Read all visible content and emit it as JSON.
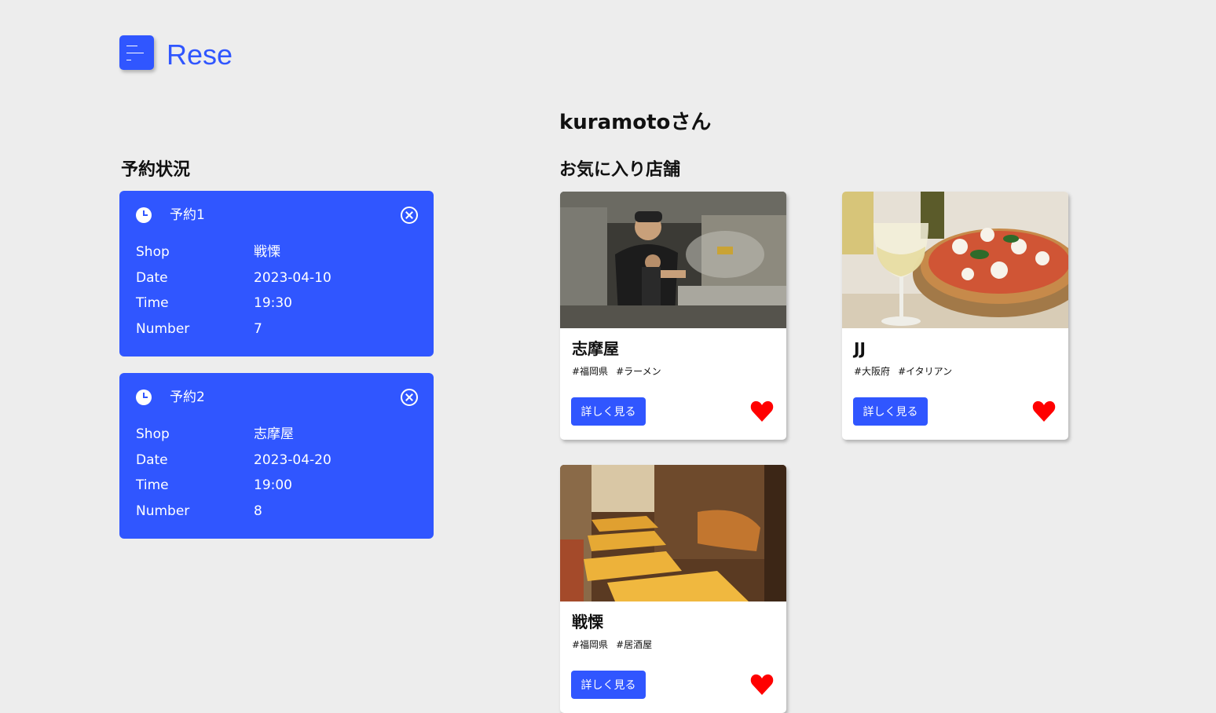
{
  "header": {
    "logo": "Rese",
    "menu_icon": "hamburger-menu-icon",
    "accent_color": "#3056ff"
  },
  "user": {
    "greeting": "kuramotoさん"
  },
  "reservations": {
    "title": "予約状況",
    "items": [
      {
        "label": "予約1",
        "shop_label": "Shop",
        "shop": "戦慄",
        "date_label": "Date",
        "date": "2023-04-10",
        "time_label": "Time",
        "time": "19:30",
        "number_label": "Number",
        "number": "7"
      },
      {
        "label": "予約2",
        "shop_label": "Shop",
        "shop": "志摩屋",
        "date_label": "Date",
        "date": "2023-04-20",
        "time_label": "Time",
        "time": "19:00",
        "number_label": "Number",
        "number": "8"
      }
    ]
  },
  "favorites": {
    "title": "お気に入り店舗",
    "heart_color": "#ff0000",
    "shops": [
      {
        "name": "志摩屋",
        "tags": [
          "#福岡県",
          "#ラーメン"
        ],
        "button": "詳しく見る"
      },
      {
        "name": "JJ",
        "tags": [
          "#大阪府",
          "#イタリアン"
        ],
        "button": "詳しく見る"
      },
      {
        "name": "戦慄",
        "tags": [
          "#福岡県",
          "#居酒屋"
        ],
        "button": "詳しく見る"
      }
    ]
  }
}
